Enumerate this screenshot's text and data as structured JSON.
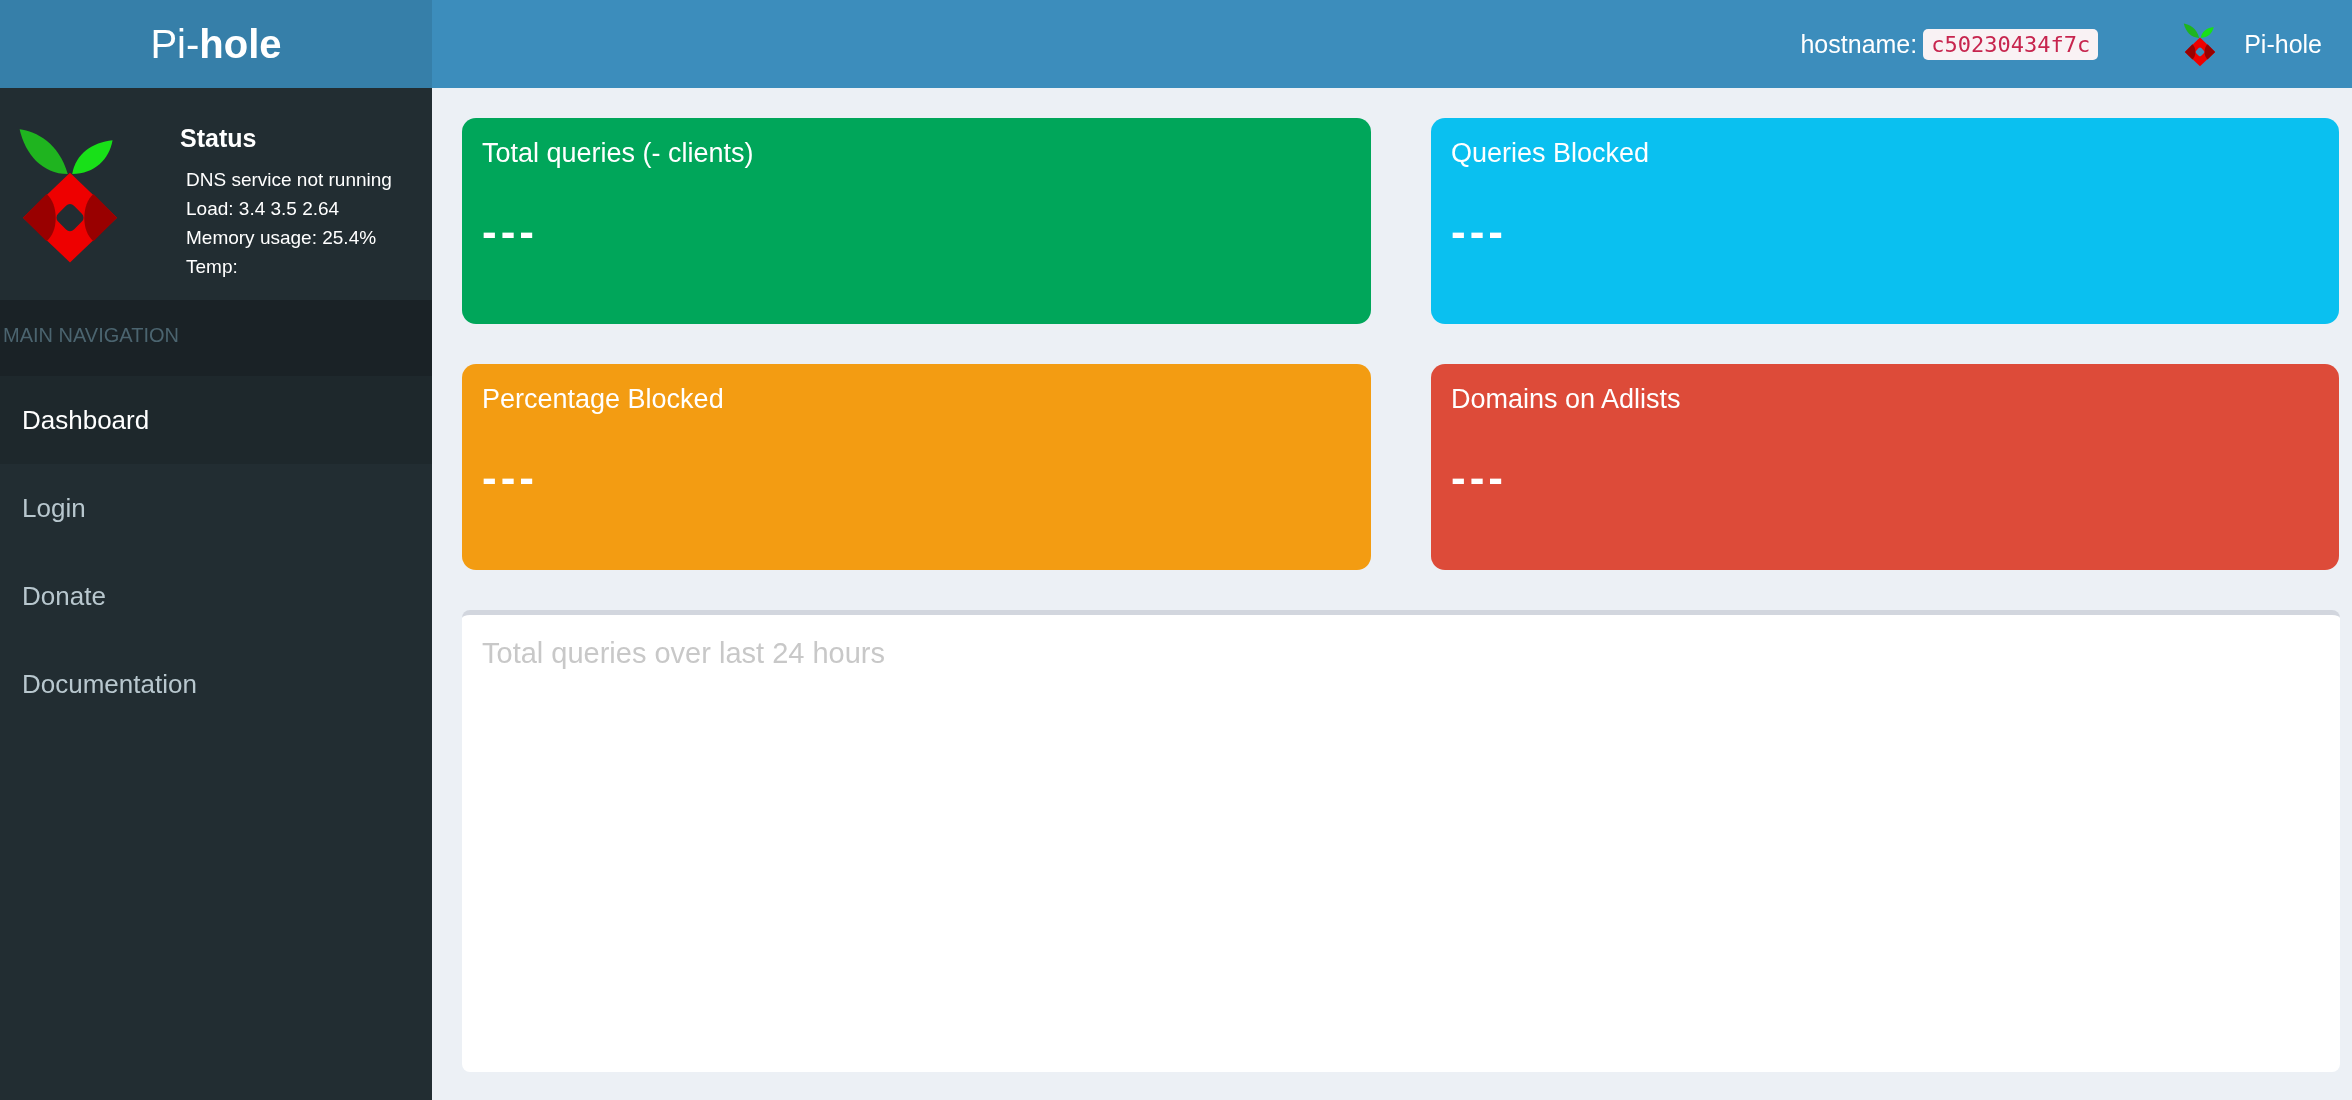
{
  "sidebar": {
    "logo": "Pi-**hole**",
    "status": {
      "title": "Status",
      "lines": [
        "DNS service not running",
        "Load:  3.4  3.5  2.64",
        "Memory usage:  25.4%",
        "Temp:"
      ]
    },
    "section_header": "MAIN NAVIGATION",
    "items": [
      {
        "label": "Dashboard",
        "selected": true
      },
      {
        "label": "Login",
        "selected": false
      },
      {
        "label": "Donate",
        "selected": false
      },
      {
        "label": "Documentation",
        "selected": false
      }
    ]
  },
  "header": {
    "hostname_label": "hostname:",
    "hostname": "c50230434f7c",
    "brand": "Pi-hole"
  },
  "stat_cards": [
    {
      "title": "Total queries (- clients)",
      "value": "---",
      "color": "#00a65a"
    },
    {
      "title": "Queries Blocked",
      "value": "---",
      "color": "#0ac0f0"
    },
    {
      "title": "Percentage Blocked",
      "value": "---",
      "color": "#f39c12"
    },
    {
      "title": "Domains on Adlists",
      "value": "---",
      "color": "#dd4b39"
    }
  ],
  "chart_panel": {
    "title": "Total queries over last 24 hours"
  }
}
